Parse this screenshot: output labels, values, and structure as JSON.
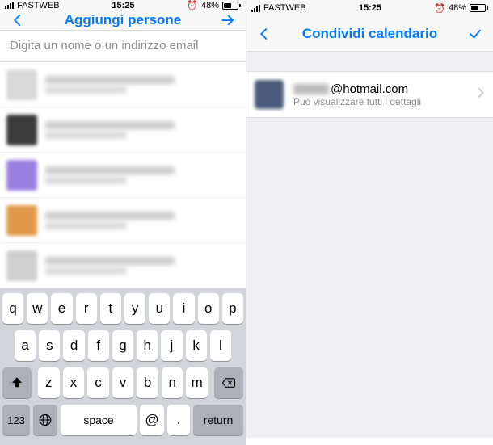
{
  "status": {
    "carrier": "FASTWEB",
    "time": "15:25",
    "battery_pct": "48%"
  },
  "left_screen": {
    "nav_title": "Aggiungi persone",
    "search_placeholder": "Digita un nome o un indirizzo email",
    "contacts": [
      {
        "avatar_color": "#d9d9d9"
      },
      {
        "avatar_color": "#3b3b3b"
      },
      {
        "avatar_color": "#9b7fe0"
      },
      {
        "avatar_color": "#e09a4a"
      },
      {
        "avatar_color": "#cfcfcf"
      }
    ],
    "keyboard": {
      "row1": [
        "q",
        "w",
        "e",
        "r",
        "t",
        "y",
        "u",
        "i",
        "o",
        "p"
      ],
      "row2": [
        "a",
        "s",
        "d",
        "f",
        "g",
        "h",
        "j",
        "k",
        "l"
      ],
      "row3": [
        "z",
        "x",
        "c",
        "v",
        "b",
        "n",
        "m"
      ],
      "num_label": "123",
      "space_label": "space",
      "at_label": "@",
      "dot_label": ".",
      "return_label": "return"
    }
  },
  "right_screen": {
    "nav_title": "Condividi calendario",
    "shared": {
      "email_suffix": "@hotmail.com",
      "subtitle": "Può visualizzare tutti i dettagli"
    }
  }
}
